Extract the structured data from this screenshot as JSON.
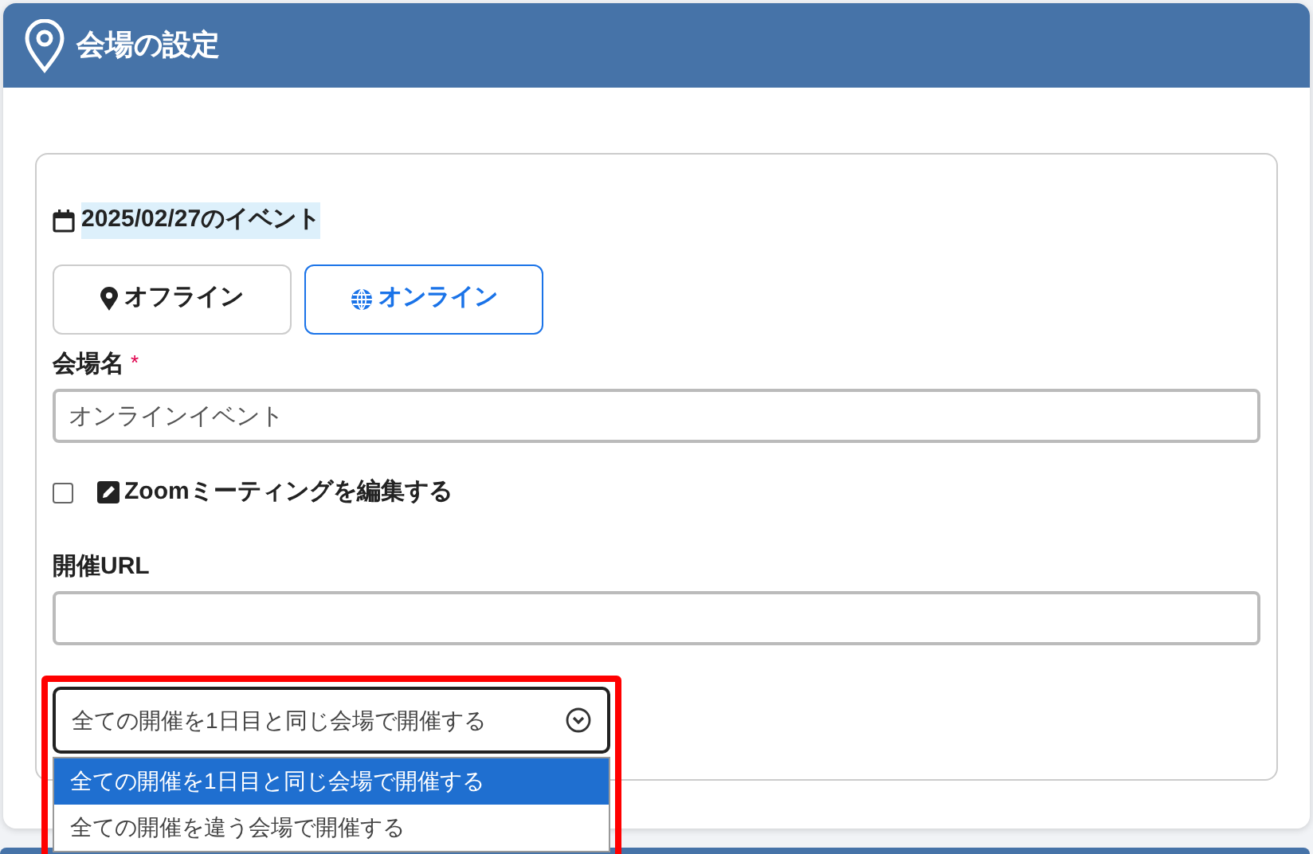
{
  "header": {
    "title": "会場の設定"
  },
  "event_date": {
    "text": "2025/02/27のイベント"
  },
  "mode_buttons": [
    {
      "label": "オフライン",
      "kind": "offline",
      "selected": false
    },
    {
      "label": "オンライン",
      "kind": "online",
      "selected": true
    }
  ],
  "venue_name": {
    "label": "会場名",
    "required_mark": "*",
    "value": "オンラインイベント"
  },
  "zoom_edit": {
    "label": "Zoomミーティングを編集する",
    "checked": false
  },
  "url": {
    "label": "開催URL"
  },
  "venue_select": {
    "value": "全ての開催を1日目と同じ会場で開催する",
    "expanded": true,
    "highlighted": true,
    "options": [
      {
        "label": "全ての開催を1日目と同じ会場で開催する",
        "selected": true
      },
      {
        "label": "全ての開催を違う会場で開催する",
        "selected": false
      }
    ]
  }
}
